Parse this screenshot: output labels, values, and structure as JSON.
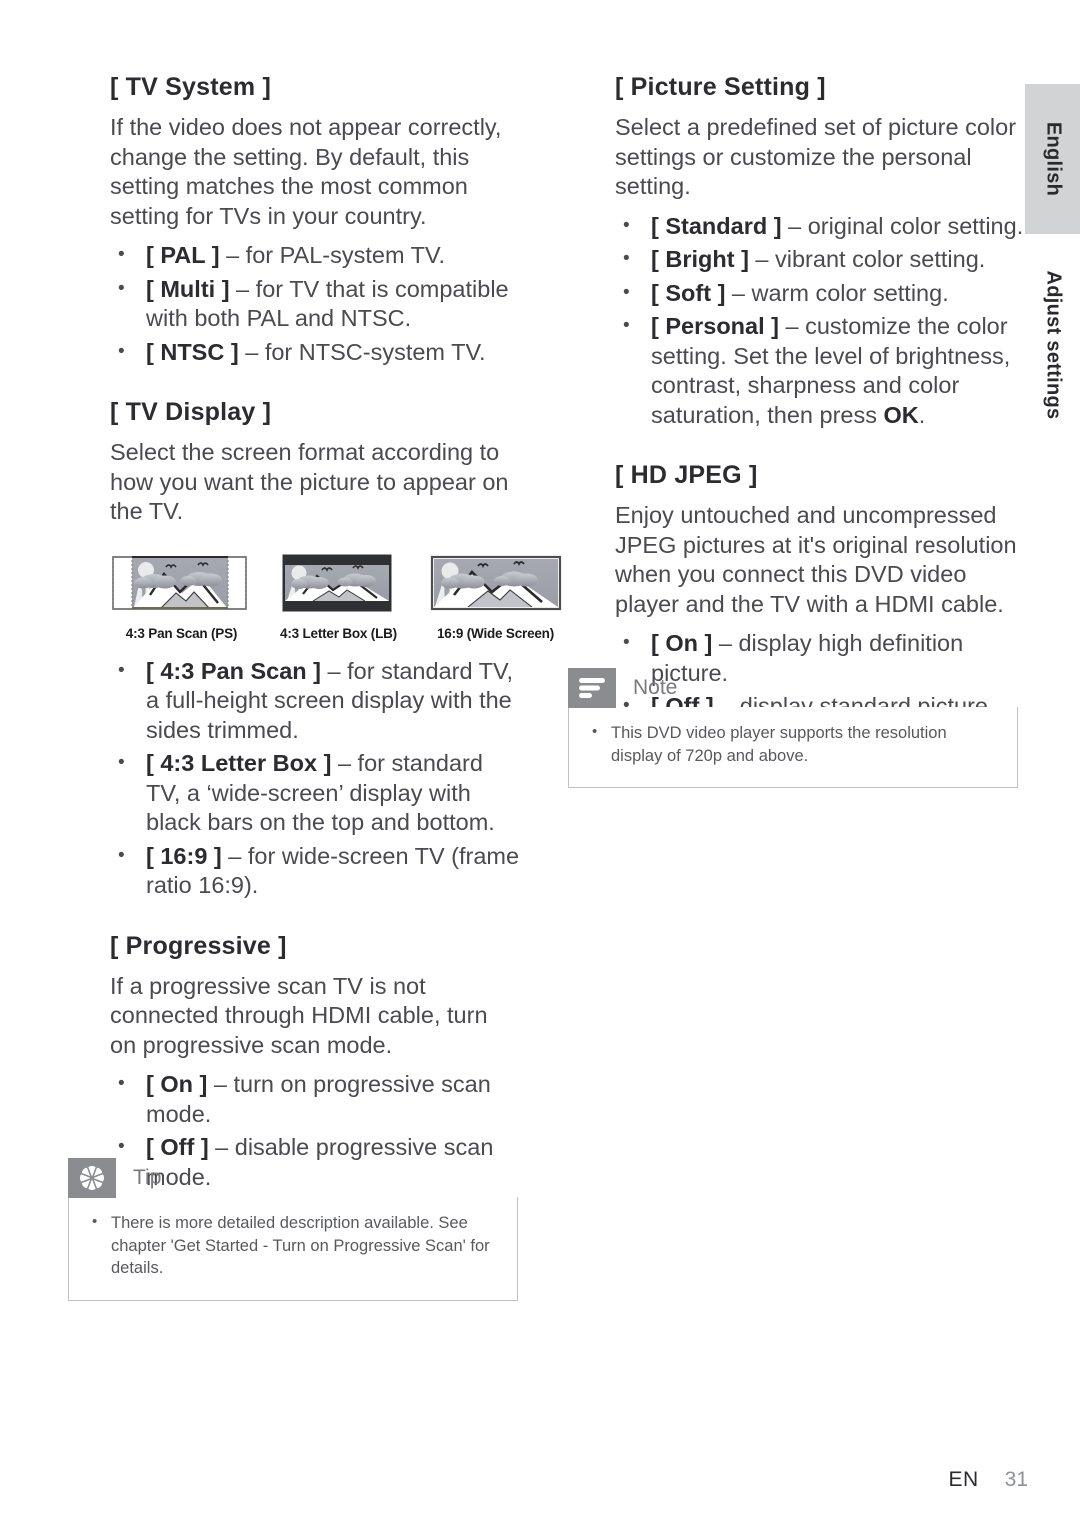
{
  "side_tab": {
    "language": "English",
    "section": "Adjust settings"
  },
  "footer": {
    "language_code": "EN",
    "page_number": "31"
  },
  "left_column": {
    "tv_system": {
      "title": "[ TV System ]",
      "paragraph": "If the video does not appear correctly, change the setting. By default, this setting matches the most common setting for TVs in your country.",
      "bullets": [
        {
          "token": "[ PAL ]",
          "text": " – for PAL-system TV."
        },
        {
          "token": "[ Multi ]",
          "text": " – for TV that is compatible with both PAL and NTSC."
        },
        {
          "token": "[ NTSC ]",
          "text": " – for NTSC-system TV."
        }
      ]
    },
    "tv_display": {
      "title": "[ TV Display ]",
      "paragraph": "Select the screen format according to how you want the picture to appear on the TV.",
      "figures": [
        {
          "caption": "4:3 Pan Scan (PS)",
          "name": "pan-scan"
        },
        {
          "caption": "4:3 Letter Box (LB)",
          "name": "letter-box"
        },
        {
          "caption": "16:9 (Wide Screen)",
          "name": "wide-screen"
        }
      ],
      "bullets": [
        {
          "token": "[ 4:3 Pan Scan ]",
          "text": " – for standard TV, a full-height screen display with the sides trimmed."
        },
        {
          "token": "[ 4:3 Letter Box ]",
          "text": " – for standard TV,  a ‘wide-screen’ display with black bars on the top and bottom."
        },
        {
          "token": "[ 16:9 ]",
          "text": " – for wide-screen TV (frame ratio 16:9)."
        }
      ]
    },
    "progressive": {
      "title": "[ Progressive ]",
      "paragraph": "If a progressive scan TV is not connected through HDMI cable, turn on progressive scan mode.",
      "bullets": [
        {
          "token": "[ On ]",
          "text": " – turn on progressive scan mode."
        },
        {
          "token": "[ Off ]",
          "text": " – disable progressive scan mode."
        }
      ]
    },
    "tip": {
      "icon": "asterisk-flower-icon",
      "title": "Tip",
      "items": [
        "There is more detailed description available. See chapter 'Get Started - Turn on Progressive Scan' for details."
      ]
    }
  },
  "right_column": {
    "picture_setting": {
      "title": "[ Picture Setting ]",
      "paragraph": "Select a predefined set of picture color settings or customize the personal setting.",
      "bullets": [
        {
          "token": "[ Standard ]",
          "text": " – original color setting."
        },
        {
          "token": "[ Bright ]",
          "text": " – vibrant color setting."
        },
        {
          "token": "[ Soft ]",
          "text": " – warm color setting."
        },
        {
          "token": "[ Personal ]",
          "text": " – customize the color setting. Set the level of brightness, contrast, sharpness and color saturation, then press ",
          "token_end": "OK",
          "text_end": "."
        }
      ]
    },
    "hd_jpeg": {
      "title": "[ HD JPEG ]",
      "paragraph": "Enjoy untouched and uncompressed JPEG pictures at it's original resolution when you connect this DVD video player and the TV with a HDMI cable.",
      "bullets": [
        {
          "token": "[ On ]",
          "text": " – display high definition picture."
        },
        {
          "token": "[ Off ]",
          "text": " – display standard picture."
        }
      ]
    },
    "note": {
      "icon": "note-lines-icon",
      "title": "Note",
      "items": [
        "This DVD video player supports the resolution display of 720p and above."
      ]
    }
  },
  "colors": {
    "tab_gray": "#d2d3d5",
    "callout_icon_gray": "#8a8c8f",
    "callout_border": "#bfc1c4",
    "body_text": "#4a4a50",
    "heading_text": "#2b2b30"
  }
}
